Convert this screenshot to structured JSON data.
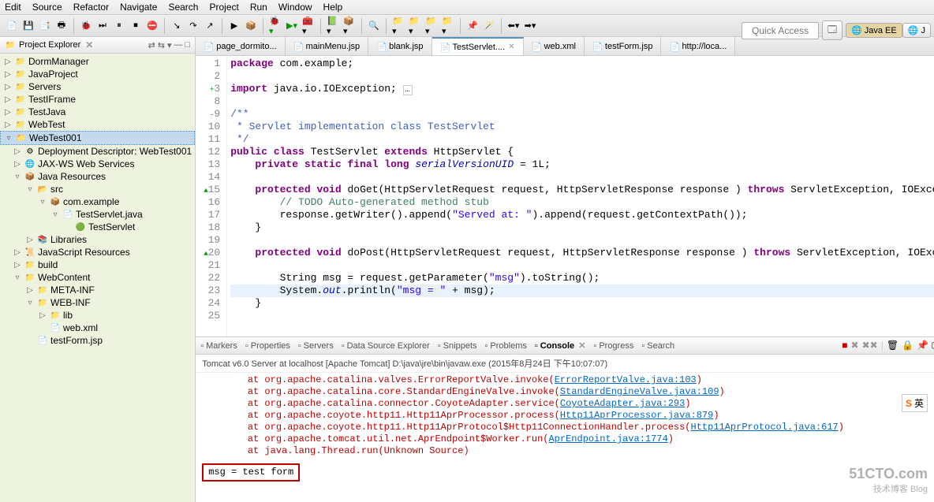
{
  "menubar": [
    "Edit",
    "Source",
    "Refactor",
    "Navigate",
    "Search",
    "Project",
    "Run",
    "Window",
    "Help"
  ],
  "quick_access": "Quick Access",
  "perspectives": [
    {
      "label": "Java EE",
      "icon": "globe"
    },
    {
      "label": "J",
      "icon": "j"
    }
  ],
  "project_explorer": {
    "title": "Project Explorer",
    "items": [
      {
        "lvl": 0,
        "exp": "▷",
        "icon": "proj",
        "label": "DormManager"
      },
      {
        "lvl": 0,
        "exp": "▷",
        "icon": "proj",
        "label": "JavaProject"
      },
      {
        "lvl": 0,
        "exp": "▷",
        "icon": "proj",
        "label": "Servers"
      },
      {
        "lvl": 0,
        "exp": "▷",
        "icon": "proj",
        "label": "TestIFrame"
      },
      {
        "lvl": 0,
        "exp": "▷",
        "icon": "proj",
        "label": "TestJava"
      },
      {
        "lvl": 0,
        "exp": "▷",
        "icon": "proj",
        "label": "WebTest"
      },
      {
        "lvl": 0,
        "exp": "▿",
        "icon": "proj",
        "label": "WebTest001",
        "sel": true
      },
      {
        "lvl": 1,
        "exp": "▷",
        "icon": "gear",
        "label": "Deployment Descriptor: WebTest001"
      },
      {
        "lvl": 1,
        "exp": "▷",
        "icon": "ws",
        "label": "JAX-WS Web Services"
      },
      {
        "lvl": 1,
        "exp": "▿",
        "icon": "src",
        "label": "Java Resources"
      },
      {
        "lvl": 2,
        "exp": "▿",
        "icon": "pkgf",
        "label": "src"
      },
      {
        "lvl": 3,
        "exp": "▿",
        "icon": "pkg",
        "label": "com.example"
      },
      {
        "lvl": 4,
        "exp": "▿",
        "icon": "java",
        "label": "TestServlet.java"
      },
      {
        "lvl": 5,
        "exp": "",
        "icon": "class",
        "label": "TestServlet"
      },
      {
        "lvl": 2,
        "exp": "▷",
        "icon": "lib",
        "label": "Libraries"
      },
      {
        "lvl": 1,
        "exp": "▷",
        "icon": "js",
        "label": "JavaScript Resources"
      },
      {
        "lvl": 1,
        "exp": "▷",
        "icon": "fld",
        "label": "build"
      },
      {
        "lvl": 1,
        "exp": "▿",
        "icon": "fld",
        "label": "WebContent"
      },
      {
        "lvl": 2,
        "exp": "▷",
        "icon": "fld",
        "label": "META-INF"
      },
      {
        "lvl": 2,
        "exp": "▿",
        "icon": "fld",
        "label": "WEB-INF"
      },
      {
        "lvl": 3,
        "exp": "▷",
        "icon": "fld",
        "label": "lib"
      },
      {
        "lvl": 3,
        "exp": "",
        "icon": "xml",
        "label": "web.xml"
      },
      {
        "lvl": 2,
        "exp": "",
        "icon": "jsp",
        "label": "testForm.jsp"
      }
    ]
  },
  "editor_tabs": [
    {
      "label": "page_dormito...",
      "icon": "jsp"
    },
    {
      "label": "mainMenu.jsp",
      "icon": "jsp"
    },
    {
      "label": "blank.jsp",
      "icon": "jsp"
    },
    {
      "label": "TestServlet....",
      "icon": "java",
      "active": true
    },
    {
      "label": "web.xml",
      "icon": "xml"
    },
    {
      "label": "testForm.jsp",
      "icon": "jsp"
    },
    {
      "label": "http://loca...",
      "icon": "globe"
    }
  ],
  "code": {
    "lines": [
      {
        "n": "1",
        "t": "package",
        "frag": [
          [
            "kw",
            "package"
          ],
          [
            "",
            " com.example;"
          ]
        ]
      },
      {
        "n": "2",
        "t": ""
      },
      {
        "n": "3",
        "ann": "+",
        "frag": [
          [
            "kw",
            "import"
          ],
          [
            "",
            " java.io.IOException;"
          ]
        ],
        "box": true
      },
      {
        "n": "8",
        "t": ""
      },
      {
        "n": "9",
        "ann": "-",
        "frag": [
          [
            "jdoc",
            "/**"
          ]
        ]
      },
      {
        "n": "10",
        "frag": [
          [
            "jdoc",
            " * Servlet implementation class TestServlet"
          ]
        ]
      },
      {
        "n": "11",
        "frag": [
          [
            "jdoc",
            " */"
          ]
        ]
      },
      {
        "n": "12",
        "frag": [
          [
            "kw",
            "public"
          ],
          [
            "",
            " "
          ],
          [
            "kw",
            "class"
          ],
          [
            "",
            " TestServlet "
          ],
          [
            "kw",
            "extends"
          ],
          [
            "",
            " HttpServlet {"
          ]
        ]
      },
      {
        "n": "13",
        "frag": [
          [
            "",
            "    "
          ],
          [
            "kw",
            "private"
          ],
          [
            "",
            " "
          ],
          [
            "kw",
            "static"
          ],
          [
            "",
            " "
          ],
          [
            "kw",
            "final"
          ],
          [
            "",
            " "
          ],
          [
            "kw",
            "long"
          ],
          [
            "",
            " "
          ],
          [
            "field",
            "serialVersionUID"
          ],
          [
            "",
            " = 1L;"
          ]
        ]
      },
      {
        "n": "14",
        "t": ""
      },
      {
        "n": "15",
        "ann": "▲",
        "frag": [
          [
            "",
            "    "
          ],
          [
            "kw",
            "protected"
          ],
          [
            "",
            " "
          ],
          [
            "kw",
            "void"
          ],
          [
            "",
            " doGet(HttpServletRequest "
          ],
          [
            "",
            "request"
          ],
          [
            "",
            ", HttpServletResponse "
          ],
          [
            "",
            "response"
          ],
          [
            "",
            " ) "
          ],
          [
            "kw",
            "throws"
          ],
          [
            "",
            " ServletException, IOException {"
          ]
        ]
      },
      {
        "n": "16",
        "frag": [
          [
            "",
            "        "
          ],
          [
            "com",
            "// TODO Auto-generated method stub"
          ]
        ]
      },
      {
        "n": "17",
        "frag": [
          [
            "",
            "        response.getWriter().append("
          ],
          [
            "str",
            "\"Served at: \""
          ],
          [
            "",
            ").append(request.getContextPath());"
          ]
        ]
      },
      {
        "n": "18",
        "frag": [
          [
            "",
            "    }"
          ]
        ]
      },
      {
        "n": "19",
        "t": ""
      },
      {
        "n": "20",
        "ann": "▲",
        "frag": [
          [
            "",
            "    "
          ],
          [
            "kw",
            "protected"
          ],
          [
            "",
            " "
          ],
          [
            "kw",
            "void"
          ],
          [
            "",
            " doPost(HttpServletRequest "
          ],
          [
            "",
            "request"
          ],
          [
            "",
            ", HttpServletResponse "
          ],
          [
            "",
            "response"
          ],
          [
            "",
            " ) "
          ],
          [
            "kw",
            "throws"
          ],
          [
            "",
            " ServletException, IOException {"
          ]
        ]
      },
      {
        "n": "21",
        "t": ""
      },
      {
        "n": "22",
        "frag": [
          [
            "",
            "        String msg = request.getParameter("
          ],
          [
            "str",
            "\"msg\""
          ],
          [
            "",
            ").toString();"
          ]
        ]
      },
      {
        "n": "23",
        "cur": true,
        "frag": [
          [
            "",
            "        System."
          ],
          [
            "field",
            "out"
          ],
          [
            "",
            ".println("
          ],
          [
            "str",
            "\"msg = \""
          ],
          [
            "",
            " + msg);"
          ]
        ]
      },
      {
        "n": "24",
        "frag": [
          [
            "",
            "    }"
          ]
        ]
      },
      {
        "n": "25",
        "t": ""
      }
    ]
  },
  "bottom_tabs": [
    {
      "label": "Markers",
      "icon": "mark"
    },
    {
      "label": "Properties",
      "icon": "prop"
    },
    {
      "label": "Servers",
      "icon": "srv"
    },
    {
      "label": "Data Source Explorer",
      "icon": "db"
    },
    {
      "label": "Snippets",
      "icon": "snip"
    },
    {
      "label": "Problems",
      "icon": "prob"
    },
    {
      "label": "Console",
      "icon": "con",
      "active": true
    },
    {
      "label": "Progress",
      "icon": "prog"
    },
    {
      "label": "Search",
      "icon": "search"
    }
  ],
  "console": {
    "title": "Tomcat v6.0 Server at localhost [Apache Tomcat] D:\\java\\jre\\bin\\javaw.exe (2015年8月24日 下午10:07:07)",
    "lines": [
      {
        "pre": "        at ",
        "txt": "org.apache.catalina.valves.ErrorReportValve.invoke(",
        "link": "ErrorReportValve.java:103",
        "post": ")"
      },
      {
        "pre": "        at ",
        "txt": "org.apache.catalina.core.StandardEngineValve.invoke(",
        "link": "StandardEngineValve.java:109",
        "post": ")"
      },
      {
        "pre": "        at ",
        "txt": "org.apache.catalina.connector.CoyoteAdapter.service(",
        "link": "CoyoteAdapter.java:293",
        "post": ")"
      },
      {
        "pre": "        at ",
        "txt": "org.apache.coyote.http11.Http11AprProcessor.process(",
        "link": "Http11AprProcessor.java:879",
        "post": ")"
      },
      {
        "pre": "        at ",
        "txt": "org.apache.coyote.http11.Http11AprProtocol$Http11ConnectionHandler.process(",
        "link": "Http11AprProtocol.java:617",
        "post": ")"
      },
      {
        "pre": "        at ",
        "txt": "org.apache.tomcat.util.net.AprEndpoint$Worker.run(",
        "link": "AprEndpoint.java:1774",
        "post": ")"
      },
      {
        "pre": "        at ",
        "txt": "java.lang.Thread.run(Unknown Source)",
        "link": "",
        "post": ""
      }
    ],
    "output": "msg = test form"
  },
  "watermark": {
    "line1": "51CTO.com",
    "line2": "技术博客    Blog"
  },
  "sogou": "英"
}
